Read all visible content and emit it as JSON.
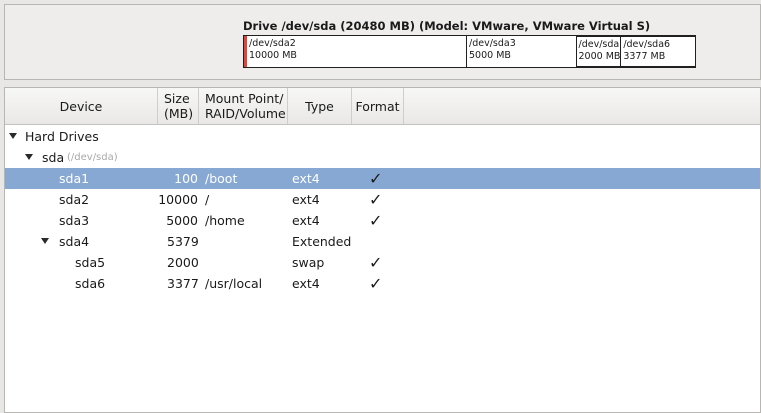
{
  "drive": {
    "title": "Drive /dev/sda (20480 MB) (Model: VMware, VMware Virtual S)",
    "segments": [
      {
        "name": "/dev/sda2",
        "size": "10000 MB"
      },
      {
        "name": "/dev/sda3",
        "size": "5000 MB"
      },
      {
        "name": "/dev/sda",
        "size": "2000 MB"
      },
      {
        "name": "/dev/sda6",
        "size": "3377 MB"
      }
    ]
  },
  "columns": {
    "device": "Device",
    "size_line1": "Size",
    "size_line2": "(MB)",
    "mount_line1": "Mount Point/",
    "mount_line2": "RAID/Volume",
    "type": "Type",
    "format": "Format"
  },
  "tree": {
    "group": "Hard Drives",
    "disk": "sda",
    "disk_path": "(/dev/sda)",
    "check_glyph": "✓",
    "rows": [
      {
        "device": "sda1",
        "size": "100",
        "mount": "/boot",
        "type": "ext4",
        "format": true
      },
      {
        "device": "sda2",
        "size": "10000",
        "mount": "/",
        "type": "ext4",
        "format": true
      },
      {
        "device": "sda3",
        "size": "5000",
        "mount": "/home",
        "type": "ext4",
        "format": true
      },
      {
        "device": "sda4",
        "size": "5379",
        "mount": "",
        "type": "Extended",
        "format": false
      },
      {
        "device": "sda5",
        "size": "2000",
        "mount": "",
        "type": "swap",
        "format": true
      },
      {
        "device": "sda6",
        "size": "3377",
        "mount": "/usr/local",
        "type": "ext4",
        "format": true
      }
    ]
  },
  "colors": {
    "selection": "#87a8d3",
    "partition_marker": "#e0453c"
  }
}
